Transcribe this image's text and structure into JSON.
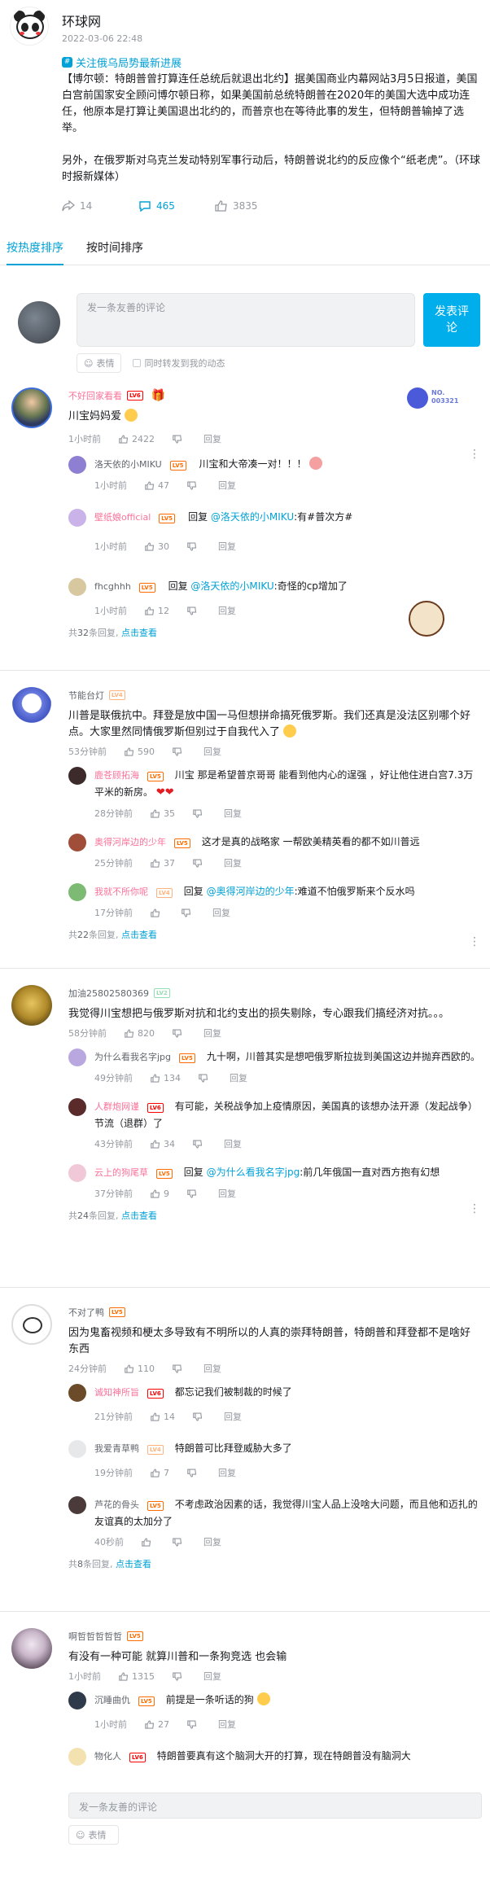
{
  "post": {
    "author": "环球网",
    "date": "2022-03-06 22:48",
    "topic": "关注俄乌局势最新进展",
    "paragraph1": "【博尔顿：特朗普曾打算连任总统后就退出北约】据美国商业内幕网站3月5日报道，美国白宫前国家安全顾问博尔顿日称，如果美国前总统特朗普在2020年的美国大选中成功连任，他原本是打算让美国退出北约的，而普京也在等待此事的发生，但特朗普输掉了选举。",
    "paragraph2": "另外，在俄罗斯对乌克兰发动特别军事行动后，特朗普说北约的反应像个“纸老虎”。（环球时报新媒体）",
    "shares": "14",
    "comments": "465",
    "likes": "3835"
  },
  "tabs": {
    "hot": "按热度排序",
    "time": "按时间排序"
  },
  "composer": {
    "placeholder": "发一条友善的评论",
    "send": "发表评论",
    "emoji": "表情",
    "repost": "同时转发到我的动态"
  },
  "labels": {
    "reply": "回复",
    "reply_prefix": "回复 ",
    "total_prefix": "共",
    "total_suffix": "条回复,",
    "view_more": "点击查看"
  },
  "comments": [
    {
      "name": "不好回家看看",
      "level": "LV6",
      "text": "川宝妈妈爱",
      "time": "1小时前",
      "likes": "2422",
      "total": "32",
      "replies": [
        {
          "name": "洛天依的小MIKU",
          "level": "LV5",
          "text": "川宝和大帝凑一对！！！",
          "time": "1小时前",
          "likes": "47"
        },
        {
          "name": "壁纸娘official",
          "level": "LV5",
          "at": "@洛天依的小MIKU",
          "text": ":有#普次方#",
          "time": "1小时前",
          "likes": "30"
        },
        {
          "name": "fhcghhh",
          "level": "LV5",
          "at": "@洛天依的小MIKU",
          "text": ":奇怪的cp增加了",
          "time": "1小时前",
          "likes": "12"
        }
      ]
    },
    {
      "name": "节能台灯",
      "level": "LV4",
      "text": "川普是联俄抗中。拜登是放中国一马但想拼命搞死俄罗斯。我们还真是没法区别哪个好点。大家里然同情俄罗斯但别过于自我代入了",
      "time": "53分钟前",
      "likes": "590",
      "total": "22",
      "replies": [
        {
          "name": "鹿苍顾拓海",
          "level": "LV5",
          "text": "川宝 那是希望普京哥哥 能看到他内心的逞强 ，好让他住进白宫7.3万平米的新房。",
          "time": "28分钟前",
          "likes": "35"
        },
        {
          "name": "奥得河岸边的少年",
          "level": "LV5",
          "text": "这才是真的战略家 一帮欧美精英看的都不如川普远",
          "time": "25分钟前",
          "likes": "37"
        },
        {
          "name": "我就不所你呢",
          "level": "LV4",
          "at": "@奥得河岸边的少年",
          "text": ":难道不怕俄罗斯来个反水吗",
          "time": "17分钟前",
          "likes": ""
        }
      ]
    },
    {
      "name": "加油25802580369",
      "level": "LV2",
      "text": "我觉得川宝想把与俄罗斯对抗和北约支出的损失剔除，专心跟我们搞经济对抗。。。",
      "time": "58分钟前",
      "likes": "820",
      "total": "24",
      "replies": [
        {
          "name": "为什么看我名字jpg",
          "level": "LV5",
          "text": "九十啊，川普其实是想吧俄罗斯拉拢到美国这边并抛弃西欧的。",
          "time": "49分钟前",
          "likes": "134"
        },
        {
          "name": "人群炮网谨",
          "level": "LV6",
          "text": "有可能，关税战争加上疫情原因，美国真的该想办法开源（发起战争）节流（退群）了",
          "time": "43分钟前",
          "likes": "34"
        },
        {
          "name": "云上的狗尾草",
          "level": "LV5",
          "at": "@为什么看我名字jpg",
          "text": ":前几年俄国一直对西方抱有幻想",
          "time": "37分钟前",
          "likes": "9"
        }
      ]
    },
    {
      "name": "不对了鸭",
      "level": "LV5",
      "text": "因为鬼畜视频和梗太多导致有不明所以的人真的崇拜特朗普，特朗普和拜登都不是啥好东西",
      "time": "24分钟前",
      "likes": "110",
      "total": "8",
      "replies": [
        {
          "name": "诚知神所旨",
          "level": "LV6",
          "text": "都忘记我们被制裁的时候了",
          "time": "21分钟前",
          "likes": "14"
        },
        {
          "name": "我爱青草鸭",
          "level": "LV4",
          "text": "特朗普可比拜登威胁大多了",
          "time": "19分钟前",
          "likes": "7"
        },
        {
          "name": "芦花的骨头",
          "level": "LV5",
          "text": "不考虑政治因素的话，我觉得川宝人品上没啥大问题，而且他和迈扎的友谊真的太加分了",
          "time": "40秒前",
          "likes": ""
        }
      ]
    },
    {
      "name": "啊哲哲哲哲哲",
      "level": "LV5",
      "text": "有没有一种可能 就算川普和一条狗竞选 也会输",
      "time": "1小时前",
      "likes": "1315",
      "replies": [
        {
          "name": "沉睡曲仇",
          "level": "LV5",
          "text": "前提是一条听话的狗",
          "time": "1小时前",
          "likes": "27"
        },
        {
          "name": "物化人",
          "level": "LV6",
          "text": "特朗普要真有这个脑洞大开的打算，现在特朗普没有脑洞大"
        }
      ]
    }
  ],
  "deco": {
    "fan_badge_text": "NO.",
    "fan_badge_num": "003321"
  }
}
